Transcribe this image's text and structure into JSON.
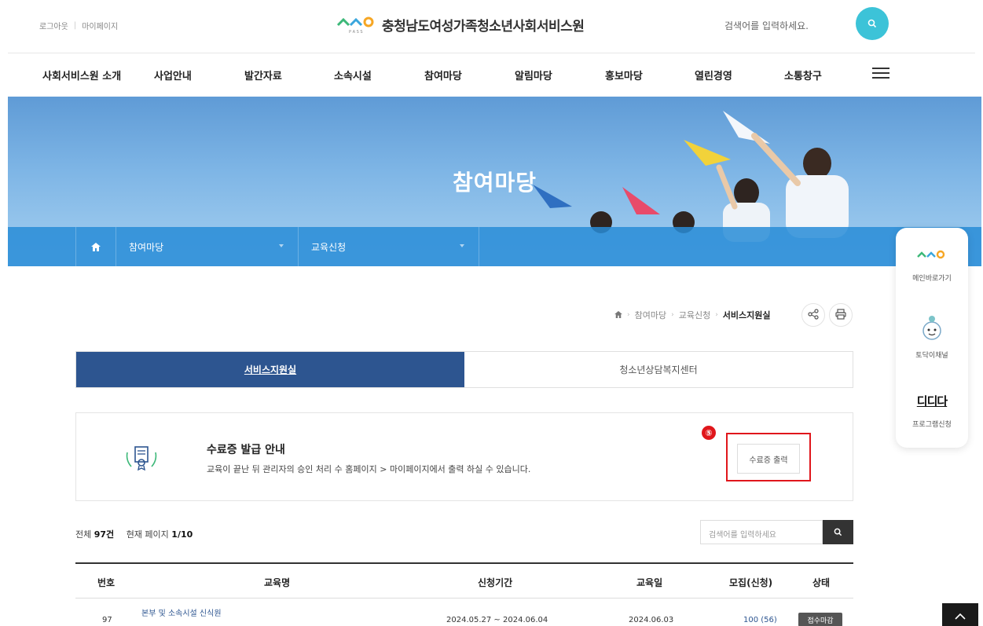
{
  "header": {
    "util_links": [
      "로그아웃",
      "마이페이지"
    ],
    "site_title": "충청남도여성가족청소년사회서비스원",
    "search_placeholder": "검색어를 입력하세요."
  },
  "gnb": [
    "사회서비스원 소개",
    "사업안내",
    "발간자료",
    "소속시설",
    "참여마당",
    "알림마당",
    "홍보마당",
    "열린경영",
    "소통창구"
  ],
  "banner": {
    "title": "참여마당",
    "crumb_menu_1": "참여마당",
    "crumb_menu_2": "교육신청"
  },
  "quick_menu": [
    {
      "label": "메인바로가기",
      "icon": "logo-icon"
    },
    {
      "label": "토닥이채널",
      "icon": "mascot-icon"
    },
    {
      "label": "프로그램신청",
      "icon": "program-logo-icon",
      "logo_text": "디디다"
    }
  ],
  "location": {
    "items": [
      "참여마당",
      "교육신청"
    ],
    "current": "서비스지원실"
  },
  "tabs": [
    {
      "label": "서비스지원실",
      "active": true
    },
    {
      "label": "청소년상담복지센터",
      "active": false
    }
  ],
  "certificate": {
    "heading": "수료증 발급 안내",
    "description": "교육이 끝난 뒤 관리자의 승인 처리 수 홈페이지 > 마이페이지에서 출력 하실 수 있습니다.",
    "button_label": "수료증 출력",
    "annotation_number": "⑤"
  },
  "list": {
    "total_label": "전체",
    "total_count": "97건",
    "page_label": "현재 페이지",
    "page_value": "1/10",
    "search_placeholder": "검색어를 입력하세요"
  },
  "table": {
    "headers": [
      "번호",
      "교육명",
      "신청기간",
      "교육일",
      "모집(신청)",
      "상태"
    ],
    "rows": [
      {
        "no": "97",
        "title": "본부 및 소속시설 신식원",
        "period": "2024.05.27 ~ 2024.06.04",
        "date": "2024.06.03",
        "recruit": "100 (56)",
        "status": "접수마감"
      }
    ]
  },
  "colors": {
    "accent_teal": "#3cc3d8",
    "tab_active": "#2d5590",
    "highlight_red": "#e0161b",
    "crumb_bar": "#288cd7"
  }
}
